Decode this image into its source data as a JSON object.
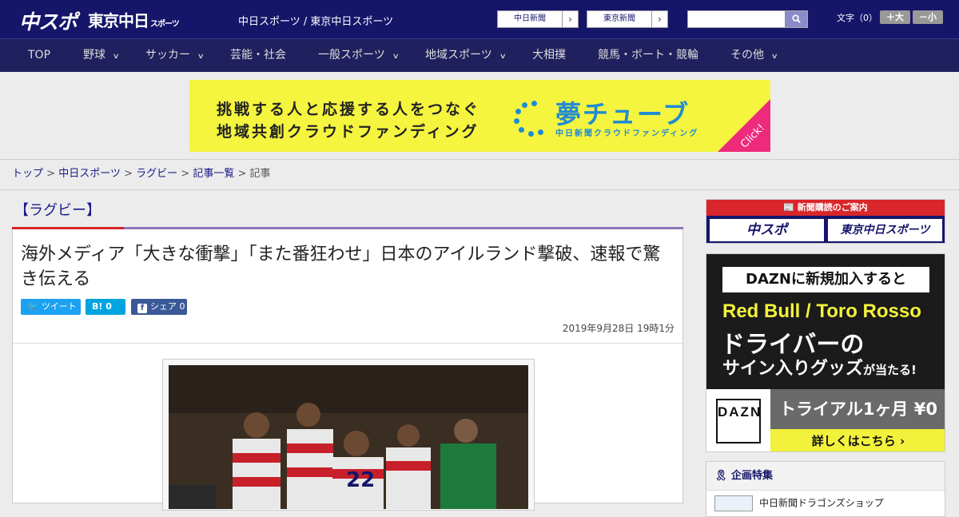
{
  "header": {
    "logo_main": "中スポ",
    "logo_tokyo": "東京中日",
    "logo_tokyo_small": "スポーツ",
    "site_name": "中日スポーツ / 東京中日スポーツ",
    "newspaper_buttons": [
      {
        "label": "中日新聞",
        "arrow": "›"
      },
      {
        "label": "東京新聞",
        "arrow": "›"
      }
    ],
    "search": {
      "placeholder": "",
      "button_icon": "search-icon"
    },
    "text_size": {
      "label": "文字（0）",
      "increase": "＋大",
      "decrease": "－小"
    }
  },
  "nav": {
    "items": [
      {
        "label": "TOP",
        "has_menu": false
      },
      {
        "label": "野球",
        "has_menu": true
      },
      {
        "label": "サッカー",
        "has_menu": true
      },
      {
        "label": "芸能・社会",
        "has_menu": false
      },
      {
        "label": "一般スポーツ",
        "has_menu": true
      },
      {
        "label": "地域スポーツ",
        "has_menu": true
      },
      {
        "label": "大相撲",
        "has_menu": false
      },
      {
        "label": "競馬・ボート・競輪",
        "has_menu": false
      },
      {
        "label": "その他",
        "has_menu": true
      }
    ],
    "chevron": "∨"
  },
  "ad_banner": {
    "line1": "挑戦する人と応援する人をつなぐ",
    "line2": "地域共創クラウドファンディング",
    "brand": "夢チューブ",
    "brand_sub": "中日新聞クラウドファンディング",
    "click": "Click!"
  },
  "breadcrumb": {
    "items": [
      "トップ",
      "中日スポーツ",
      "ラグビー",
      "記事一覧"
    ],
    "current": "記事",
    "separator": ">"
  },
  "article": {
    "category": "【ラグビー】",
    "headline": "海外メディア「大きな衝撃」「また番狂わせ」日本のアイルランド撃破、速報で驚き伝える",
    "share": [
      {
        "label": "ツイート",
        "color": "#1da1f2"
      },
      {
        "label": "B! 0",
        "color": "#00a4de"
      },
      {
        "label": "シェア 0",
        "color": "#3b5998"
      }
    ],
    "date": "2019年9月28日 19時1分",
    "photo_number": "22"
  },
  "sidebar": {
    "subscribe_head": "新聞購読のご案内",
    "subscribe_buttons": [
      "中スポ",
      "東京中日スポーツ"
    ],
    "dazn": {
      "top": "DAZNに新規加入すると",
      "teams": "Red Bull / Toro Rosso",
      "driver": "ドライバーの",
      "goods": "サイン入りグッズ",
      "goods_suffix": "が当たる!",
      "logo": "DAZN",
      "trial": "トライアル1ヶ月 ¥0",
      "more": "詳しくはこちら ›"
    },
    "plan": {
      "title": "企画特集",
      "item": "中日新聞ドラゴンズショップ"
    }
  },
  "colors": {
    "header_bg": "#15156a",
    "nav_bg": "#20205e",
    "accent_red": "#d9262a",
    "accent_purple": "#8b78b8",
    "link": "#1a1a8a"
  }
}
